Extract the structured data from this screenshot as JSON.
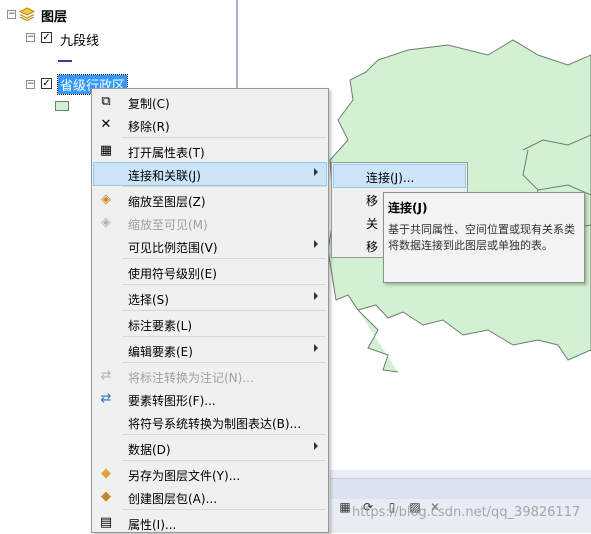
{
  "toc": {
    "root_label": "图层",
    "layers": [
      {
        "label": "九段线",
        "checked": true,
        "symbol_color": "#5b2b93"
      },
      {
        "label": "省级行政区",
        "checked": true,
        "selected": true,
        "symbol_color": "#d3f0d2"
      }
    ]
  },
  "context_menu": {
    "items": [
      {
        "label": "复制(C)",
        "icon": "copy-icon",
        "enabled": true
      },
      {
        "label": "移除(R)",
        "icon": "remove-icon",
        "enabled": true
      },
      {
        "label": "打开属性表(T)",
        "icon": "table-icon",
        "enabled": true
      },
      {
        "label": "连接和关联(J)",
        "icon": "",
        "enabled": true,
        "submenu": true,
        "highlighted": true
      },
      {
        "label": "缩放至图层(Z)",
        "icon": "zoom-to-layer-icon",
        "enabled": true
      },
      {
        "label": "缩放至可见(M)",
        "icon": "zoom-to-visible-icon",
        "enabled": false
      },
      {
        "label": "可见比例范围(V)",
        "icon": "",
        "enabled": true,
        "submenu": true
      },
      {
        "label": "使用符号级别(E)",
        "icon": "",
        "enabled": true
      },
      {
        "label": "选择(S)",
        "icon": "",
        "enabled": true,
        "submenu": true
      },
      {
        "label": "标注要素(L)",
        "icon": "",
        "enabled": true
      },
      {
        "label": "编辑要素(E)",
        "icon": "",
        "enabled": true,
        "submenu": true
      },
      {
        "label": "将标注转换为注记(N)...",
        "icon": "convert-labels-icon",
        "enabled": false
      },
      {
        "label": "要素转图形(F)...",
        "icon": "features-to-graphics-icon",
        "enabled": true
      },
      {
        "label": "将符号系统转换为制图表达(B)...",
        "icon": "",
        "enabled": true
      },
      {
        "label": "数据(D)",
        "icon": "",
        "enabled": true,
        "submenu": true
      },
      {
        "label": "另存为图层文件(Y)...",
        "icon": "save-layer-icon",
        "enabled": true
      },
      {
        "label": "创建图层包(A)...",
        "icon": "layer-package-icon",
        "enabled": true
      },
      {
        "label": "属性(I)...",
        "icon": "properties-icon",
        "enabled": true
      }
    ]
  },
  "submenu": {
    "items": [
      {
        "label": "连接(J)...",
        "highlighted": true
      },
      {
        "label": "移"
      },
      {
        "label": "关"
      },
      {
        "label": "移"
      }
    ]
  },
  "tooltip": {
    "title": "连接(J)",
    "body": "基于共同属性、空间位置或现有关系类将数据连接到此图层或单独的表。"
  },
  "map": {
    "fill_color": "#d3f0d2",
    "stroke_color": "#6e7d6e"
  },
  "watermark": "https://blog.csdn.net/qq_39826117"
}
